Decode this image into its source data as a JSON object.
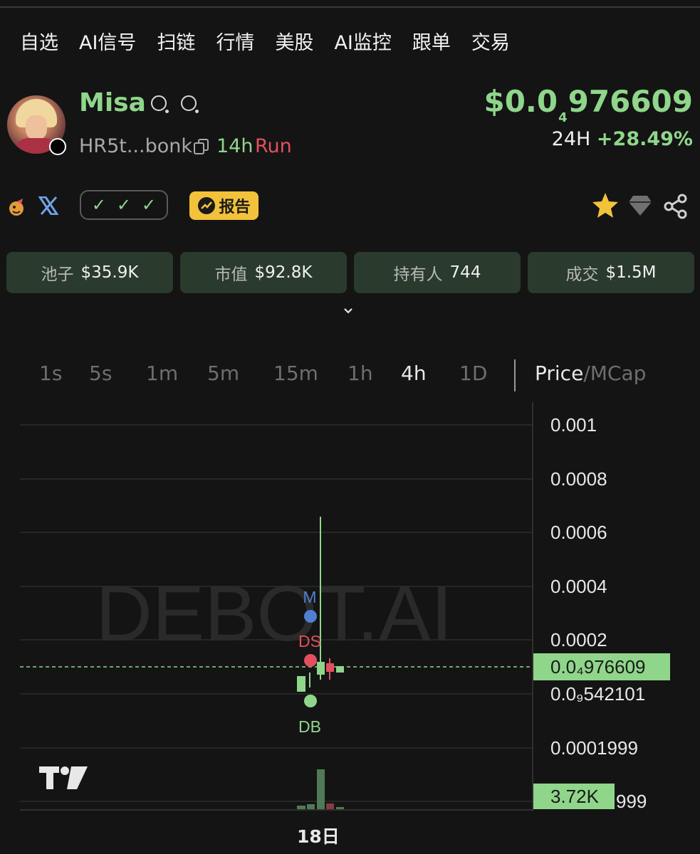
{
  "nav": {
    "items": [
      "自选",
      "AI信号",
      "扫链",
      "行情",
      "美股",
      "AI监控",
      "跟单",
      "交易"
    ]
  },
  "token": {
    "name": "Misa",
    "address": "HR5t...bonk",
    "age": "14h",
    "status": "Run",
    "price_prefix": "$0.0",
    "price_zeros": "4",
    "price_digits": "976609",
    "change_label": "24H",
    "change_value": "+28.49%"
  },
  "badges": {
    "checks": [
      "✓",
      "✓",
      "✓"
    ],
    "report_label": "报告"
  },
  "stats": [
    {
      "key": "池子",
      "value": "$35.9K"
    },
    {
      "key": "市值",
      "value": "$92.8K"
    },
    {
      "key": "持有人",
      "value": "744"
    },
    {
      "key": "成交",
      "value": "$1.5M"
    }
  ],
  "timeframes": [
    "1s",
    "5s",
    "1m",
    "5m",
    "15m",
    "1h",
    "4h",
    "1D"
  ],
  "active_timeframe": "4h",
  "mode": {
    "price": "Price",
    "sep": "/",
    "mcap": "MCap"
  },
  "chart_data": {
    "type": "candlestick",
    "y_tick_labels": [
      "0.001",
      "0.0008",
      "0.0006",
      "0.0004",
      "0.0002",
      "0.0₉542101",
      "0.0001999",
      "999"
    ],
    "y_tick_values": [
      0.001,
      0.0008,
      0.0006,
      0.0004,
      0.0002,
      5.42101e-11,
      0.0001999,
      9.99e-05
    ],
    "current_price_label": "0.0₄976609",
    "volume_label": "3.72K",
    "x_tick_labels": [
      "18日"
    ],
    "markers": [
      "M",
      "DS",
      "DB"
    ],
    "watermark": "DEBOT.AI",
    "colors": {
      "up": "#8fd68b",
      "down": "#e2505f",
      "marker_m": "#4f7fd0"
    }
  }
}
